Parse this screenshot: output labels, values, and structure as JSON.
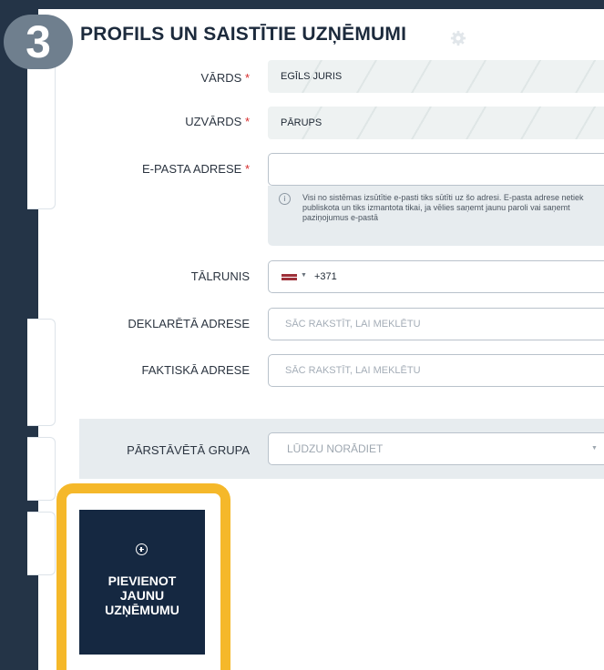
{
  "step_number": "3",
  "header": {
    "title": "PROFILS UN SAISTĪTIE UZŅĒMUMI"
  },
  "form": {
    "required_mark": "*",
    "first_name": {
      "label": "VĀRDS",
      "value": "EGĪLS JURIS"
    },
    "last_name": {
      "label": "UZVĀRDS",
      "value": "PĀRUPS"
    },
    "email": {
      "label": "E-PASTA ADRESE",
      "value": "",
      "hint": "Visi no sistēmas izsūtītie e-pasti tiks sūtīti uz šo adresi. E-pasta adrese netiek publiskota un tiks izmantota tikai, ja vēlies saņemt jaunu paroli vai saņemt paziņojumus e-pastā"
    },
    "phone": {
      "label": "TĀLRUNIS",
      "country_code": "+371",
      "flag": "latvia-flag"
    },
    "declared_address": {
      "label": "DEKLARĒTĀ ADRESE",
      "placeholder": "SĀC RAKSTĪT, LAI MEKLĒTU"
    },
    "actual_address": {
      "label": "FAKTISKĀ ADRESE",
      "placeholder": "SĀC RAKSTĪT, LAI MEKLĒTU"
    },
    "group": {
      "label": "PĀRSTĀVĒTĀ GRUPA",
      "placeholder": "LŪDZU NORĀDIET"
    }
  },
  "add_company_button": {
    "label": "PIEVIENOT\nJAUNU\nUZŅĒMUMU",
    "icon": "plus-circle-icon"
  },
  "colors": {
    "sidebar": "#243447",
    "highlight": "#f5b82a",
    "button": "#152841",
    "required": "#d62b2b"
  }
}
